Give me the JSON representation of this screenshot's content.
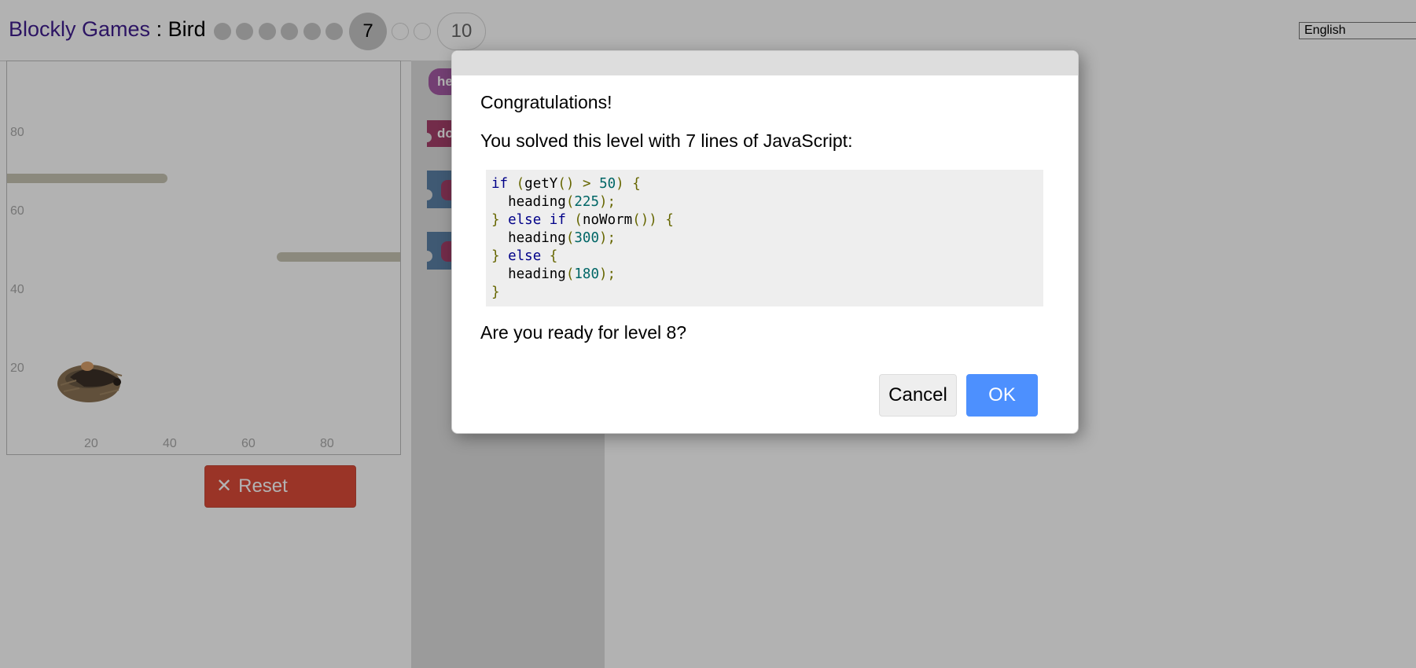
{
  "header": {
    "brand": "Blockly Games",
    "separator": " : ",
    "game": "Bird",
    "current_level": "7",
    "last_level": "10",
    "language": "English"
  },
  "visualization": {
    "y_labels": [
      "80",
      "60",
      "40",
      "20"
    ],
    "x_labels": [
      "20",
      "40",
      "60",
      "80"
    ],
    "reset_label": "Reset"
  },
  "toolbox": {
    "blocks": [
      "he",
      "do",
      "",
      ""
    ]
  },
  "dialog": {
    "title": "Congratulations!",
    "summary": "You solved this level with 7 lines of JavaScript:",
    "code_lines": [
      "if (getY() > 50) {",
      "  heading(225);",
      "} else if (noWorm()) {",
      "  heading(300);",
      "} else {",
      "  heading(180);",
      "}"
    ],
    "question": "Are you ready for level 8?",
    "cancel_label": "Cancel",
    "ok_label": "OK"
  },
  "colors": {
    "brand": "#3f1d8f",
    "reset": "#dd4b39",
    "ok": "#4d90fe",
    "heading_block": "#a55ba5",
    "do_block": "#a5406b",
    "logic_block": "#5b80a5"
  }
}
